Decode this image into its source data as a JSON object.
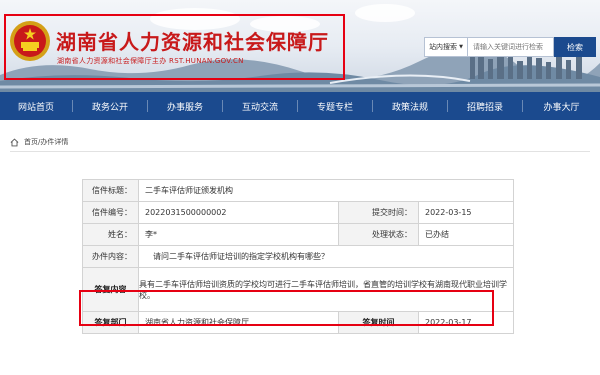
{
  "header": {
    "site_title": "湖南省人力资源和社会保障厅",
    "site_subtitle": "湖南省人力资源和社会保障厅主办   RST.HUNAN.GOV.CN",
    "emblem_icon": "national-emblem-icon",
    "search": {
      "scope_label": "站内搜索",
      "placeholder": "请输入关键词进行检索",
      "button_label": "检索"
    }
  },
  "nav": {
    "items": [
      "网站首页",
      "政务公开",
      "办事服务",
      "互动交流",
      "专题专栏",
      "政策法规",
      "招聘招录",
      "办事大厅"
    ]
  },
  "breadcrumb": {
    "home_icon": "home-icon",
    "text": "首页/办件详情"
  },
  "detail": {
    "title_label": "信件标题：",
    "title_value": "二手车评估师证颁发机构",
    "number_label": "信件编号：",
    "number_value": "2022031500000002",
    "submit_time_label": "提交时间：",
    "submit_time_value": "2022-03-15",
    "name_label": "姓名：",
    "name_value": "李*",
    "status_label": "处理状态：",
    "status_value": "已办结",
    "content_label": "办件内容：",
    "content_value": "请问二手车评估师证培训的指定学校机构有哪些？",
    "answer_label": "答复内容",
    "answer_value": "具有二手车评估师培训资质的学校均可进行二手车评估师培训，省直管的培训学校有湖南现代职业培训学校。",
    "dept_label": "答复部门",
    "dept_value": "湖南省人力资源和社会保障厅",
    "reply_time_label": "答复时间",
    "reply_time_value": "2022-03-17"
  },
  "colors": {
    "brand_red": "#c8191a",
    "nav_blue": "#1b4a8e",
    "highlight": "#e60012"
  }
}
